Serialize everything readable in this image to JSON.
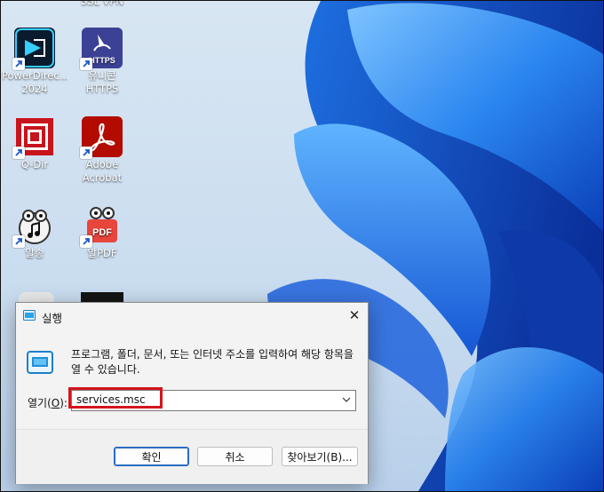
{
  "desktop": {
    "icons": [
      {
        "name": "ssl-vpn",
        "label1": "SSL VPN",
        "label2": ""
      },
      {
        "name": "powerdirector",
        "label1": "PowerDirec...",
        "label2": "2024"
      },
      {
        "name": "unicorn-https",
        "label1": "유니콘",
        "label2": "HTTPS",
        "badge": "HTTPS"
      },
      {
        "name": "q-dir",
        "label1": "Q-Dir",
        "label2": ""
      },
      {
        "name": "adobe-acrobat",
        "label1": "Adobe",
        "label2": "Acrobat"
      },
      {
        "name": "alsong",
        "label1": "알송",
        "label2": ""
      },
      {
        "name": "alpdf",
        "label1": "알PDF",
        "label2": "",
        "badge": "PDF"
      }
    ]
  },
  "dialog": {
    "title": "실행",
    "close": "✕",
    "description": "프로그램, 폴더, 문서, 또는 인터넷 주소를 입력하여 해당 항목을 열 수 있습니다.",
    "open_label_prefix": "열기(",
    "open_label_key": "O",
    "open_label_suffix": "):",
    "input_value": "services.msc",
    "buttons": {
      "ok": "확인",
      "cancel": "취소",
      "browse": "찾아보기(B)..."
    }
  },
  "colors": {
    "highlight": "#d4141c",
    "accent": "#2b6cc4"
  }
}
